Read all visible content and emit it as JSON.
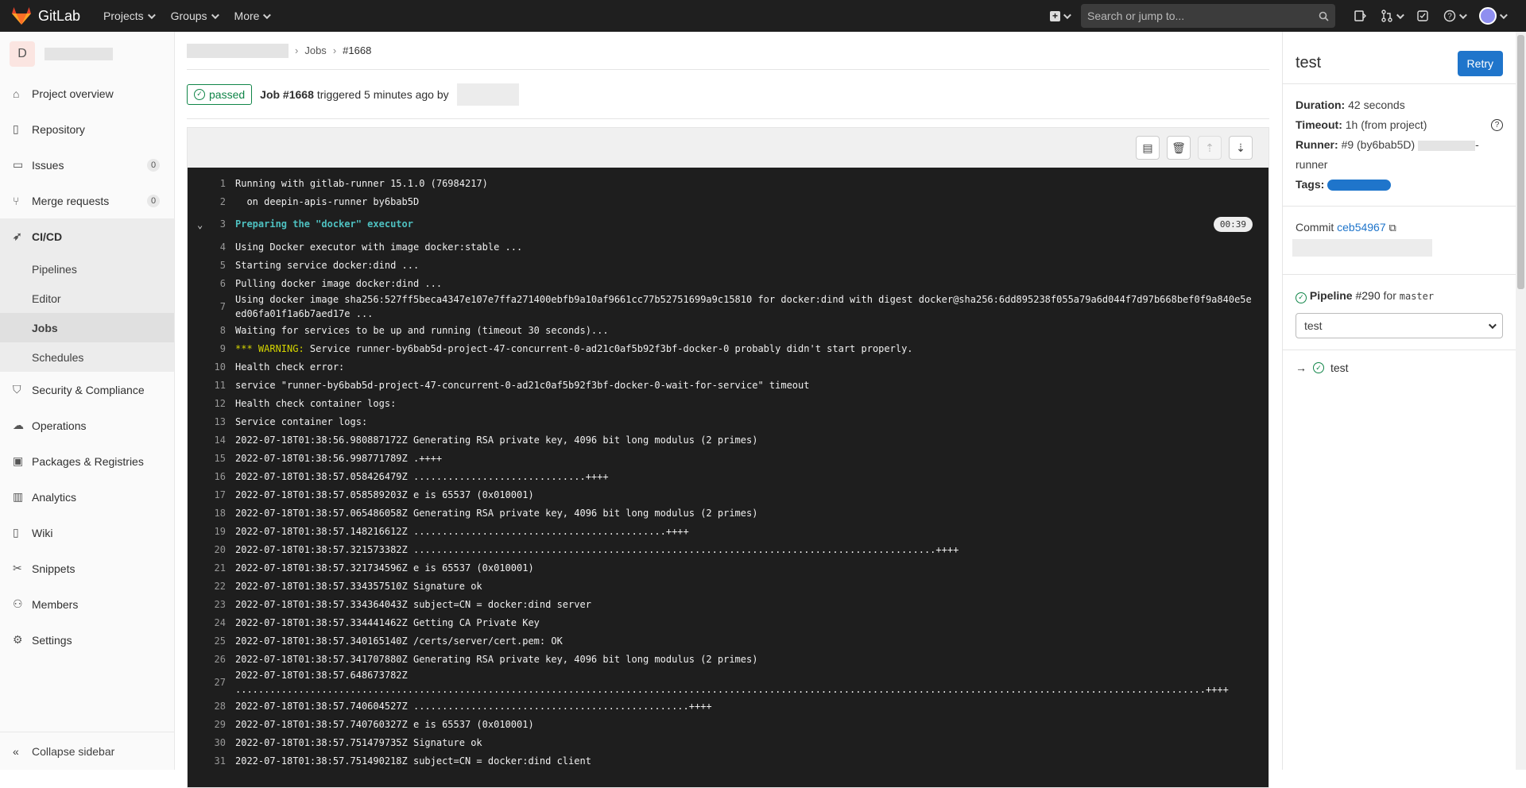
{
  "topbar": {
    "app_name": "GitLab",
    "menu": [
      {
        "label": "Projects"
      },
      {
        "label": "Groups"
      },
      {
        "label": "More"
      }
    ],
    "search_placeholder": "Search or jump to..."
  },
  "sidebar": {
    "project_initial": "D",
    "items": [
      {
        "label": "Project overview",
        "icon": "home-icon"
      },
      {
        "label": "Repository",
        "icon": "doc-icon"
      },
      {
        "label": "Issues",
        "icon": "issues-icon",
        "count": "0"
      },
      {
        "label": "Merge requests",
        "icon": "merge-request-icon",
        "count": "0"
      },
      {
        "label": "CI/CD",
        "icon": "rocket-icon"
      }
    ],
    "cicd_sub": [
      {
        "label": "Pipelines"
      },
      {
        "label": "Editor"
      },
      {
        "label": "Jobs"
      },
      {
        "label": "Schedules"
      }
    ],
    "items_after": [
      {
        "label": "Security & Compliance",
        "icon": "shield-icon"
      },
      {
        "label": "Operations",
        "icon": "cloud-icon"
      },
      {
        "label": "Packages & Registries",
        "icon": "package-icon"
      },
      {
        "label": "Analytics",
        "icon": "chart-icon"
      },
      {
        "label": "Wiki",
        "icon": "book-icon"
      },
      {
        "label": "Snippets",
        "icon": "scissors-icon"
      },
      {
        "label": "Members",
        "icon": "users-icon"
      },
      {
        "label": "Settings",
        "icon": "gear-icon"
      }
    ],
    "collapse_label": "Collapse sidebar"
  },
  "breadcrumb": {
    "jobs": "Jobs",
    "current": "#1668"
  },
  "job": {
    "status": "passed",
    "title": "Job #1668",
    "triggered": "triggered 5 minutes ago by"
  },
  "log": {
    "section_duration": "00:39",
    "lines": [
      {
        "n": "1",
        "t": "Running with gitlab-runner 15.1.0 (76984217)"
      },
      {
        "n": "2",
        "t": "  on deepin-apis-runner by6bab5D"
      },
      {
        "n": "3",
        "t": "Preparing the \"docker\" executor",
        "section": true
      },
      {
        "n": "4",
        "t": "Using Docker executor with image docker:stable ..."
      },
      {
        "n": "5",
        "t": "Starting service docker:dind ..."
      },
      {
        "n": "6",
        "t": "Pulling docker image docker:dind ..."
      },
      {
        "n": "7",
        "t": "Using docker image sha256:527ff5beca4347e107e7ffa271400ebfb9a10af9661cc77b52751699a9c15810 for docker:dind with digest docker@sha256:6dd895238f055a79a6d044f7d97b668bef0f9a840e5e ed06fa01f1a6b7aed17e ..."
      },
      {
        "n": "8",
        "t": "Waiting for services to be up and running (timeout 30 seconds)..."
      },
      {
        "n": "9",
        "w": "*** WARNING:",
        "t": " Service runner-by6bab5d-project-47-concurrent-0-ad21c0af5b92f3bf-docker-0 probably didn't start properly."
      },
      {
        "n": "10",
        "t": "Health check error:"
      },
      {
        "n": "11",
        "t": "service \"runner-by6bab5d-project-47-concurrent-0-ad21c0af5b92f3bf-docker-0-wait-for-service\" timeout"
      },
      {
        "n": "12",
        "t": "Health check container logs:"
      },
      {
        "n": "13",
        "t": "Service container logs:"
      },
      {
        "n": "14",
        "t": "2022-07-18T01:38:56.980887172Z Generating RSA private key, 4096 bit long modulus (2 primes)"
      },
      {
        "n": "15",
        "t": "2022-07-18T01:38:56.998771789Z .++++"
      },
      {
        "n": "16",
        "t": "2022-07-18T01:38:57.058426479Z ..............................++++"
      },
      {
        "n": "17",
        "t": "2022-07-18T01:38:57.058589203Z e is 65537 (0x010001)"
      },
      {
        "n": "18",
        "t": "2022-07-18T01:38:57.065486058Z Generating RSA private key, 4096 bit long modulus (2 primes)"
      },
      {
        "n": "19",
        "t": "2022-07-18T01:38:57.148216612Z ............................................++++"
      },
      {
        "n": "20",
        "t": "2022-07-18T01:38:57.321573382Z ...........................................................................................++++"
      },
      {
        "n": "21",
        "t": "2022-07-18T01:38:57.321734596Z e is 65537 (0x010001)"
      },
      {
        "n": "22",
        "t": "2022-07-18T01:38:57.334357510Z Signature ok"
      },
      {
        "n": "23",
        "t": "2022-07-18T01:38:57.334364043Z subject=CN = docker:dind server"
      },
      {
        "n": "24",
        "t": "2022-07-18T01:38:57.334441462Z Getting CA Private Key"
      },
      {
        "n": "25",
        "t": "2022-07-18T01:38:57.340165140Z /certs/server/cert.pem: OK"
      },
      {
        "n": "26",
        "t": "2022-07-18T01:38:57.341707880Z Generating RSA private key, 4096 bit long modulus (2 primes)"
      },
      {
        "n": "27",
        "t": "2022-07-18T01:38:57.648673782Z\n.........................................................................................................................................................................++++"
      },
      {
        "n": "28",
        "t": "2022-07-18T01:38:57.740604527Z ................................................++++"
      },
      {
        "n": "29",
        "t": "2022-07-18T01:38:57.740760327Z e is 65537 (0x010001)"
      },
      {
        "n": "30",
        "t": "2022-07-18T01:38:57.751479735Z Signature ok"
      },
      {
        "n": "31",
        "t": "2022-07-18T01:38:57.751490218Z subject=CN = docker:dind client"
      }
    ]
  },
  "right": {
    "title": "test",
    "retry": "Retry",
    "duration_label": "Duration:",
    "duration_value": "42 seconds",
    "timeout_label": "Timeout:",
    "timeout_value": "1h (from project)",
    "runner_label": "Runner:",
    "runner_value": "#9 (by6bab5D)",
    "runner_suffix": "-",
    "runner_line2": "runner",
    "tags_label": "Tags:",
    "commit_label": "Commit",
    "commit_sha": "ceb54967",
    "pipeline_label": "Pipeline",
    "pipeline_num": "#290",
    "pipeline_for": "for",
    "pipeline_branch": "master",
    "stage_select": "test",
    "job_name": "test"
  }
}
